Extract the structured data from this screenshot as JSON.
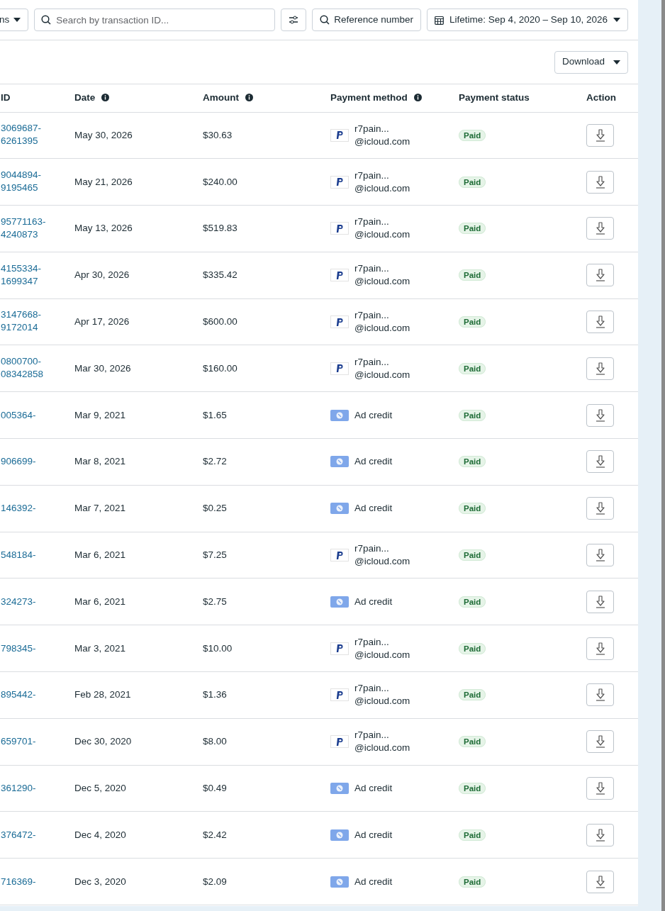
{
  "toolbar": {
    "cut_button": "ns",
    "search": {
      "placeholder": "Search by transaction ID..."
    },
    "reference_button": "Reference number",
    "date_range": "Lifetime: Sep 4, 2020 – Sep 10, 2026"
  },
  "download_button": "Download",
  "table": {
    "columns": [
      {
        "label": "ID",
        "info": false
      },
      {
        "label": "Date",
        "info": true
      },
      {
        "label": "Amount",
        "info": true
      },
      {
        "label": "Payment method",
        "info": true
      },
      {
        "label": "Payment status",
        "info": false
      },
      {
        "label": "Action",
        "info": false
      }
    ],
    "rows": [
      {
        "id": [
          "3069687-",
          "6261395"
        ],
        "date": "May 30, 2026",
        "amount": "$30.63",
        "method": {
          "kind": "paypal",
          "lines": [
            "r7pain...",
            "@icloud.com"
          ]
        },
        "status": "Paid"
      },
      {
        "id": [
          "9044894-",
          "9195465"
        ],
        "date": "May 21, 2026",
        "amount": "$240.00",
        "method": {
          "kind": "paypal",
          "lines": [
            "r7pain...",
            "@icloud.com"
          ]
        },
        "status": "Paid"
      },
      {
        "id": [
          "95771163-",
          "4240873"
        ],
        "date": "May 13, 2026",
        "amount": "$519.83",
        "method": {
          "kind": "paypal",
          "lines": [
            "r7pain...",
            "@icloud.com"
          ]
        },
        "status": "Paid"
      },
      {
        "id": [
          "4155334-",
          "1699347"
        ],
        "date": "Apr 30, 2026",
        "amount": "$335.42",
        "method": {
          "kind": "paypal",
          "lines": [
            "r7pain...",
            "@icloud.com"
          ]
        },
        "status": "Paid"
      },
      {
        "id": [
          "3147668-",
          "9172014"
        ],
        "date": "Apr 17, 2026",
        "amount": "$600.00",
        "method": {
          "kind": "paypal",
          "lines": [
            "r7pain...",
            "@icloud.com"
          ]
        },
        "status": "Paid"
      },
      {
        "id": [
          "0800700-",
          "08342858"
        ],
        "date": "Mar 30, 2026",
        "amount": "$160.00",
        "method": {
          "kind": "paypal",
          "lines": [
            "r7pain...",
            "@icloud.com"
          ]
        },
        "status": "Paid"
      },
      {
        "id": [
          "005364-"
        ],
        "date": "Mar 9, 2021",
        "amount": "$1.65",
        "method": {
          "kind": "ad_credit",
          "lines": [
            "Ad credit"
          ]
        },
        "status": "Paid"
      },
      {
        "id": [
          "906699-"
        ],
        "date": "Mar 8, 2021",
        "amount": "$2.72",
        "method": {
          "kind": "ad_credit",
          "lines": [
            "Ad credit"
          ]
        },
        "status": "Paid"
      },
      {
        "id": [
          "146392-"
        ],
        "date": "Mar 7, 2021",
        "amount": "$0.25",
        "method": {
          "kind": "ad_credit",
          "lines": [
            "Ad credit"
          ]
        },
        "status": "Paid"
      },
      {
        "id": [
          "548184-"
        ],
        "date": "Mar 6, 2021",
        "amount": "$7.25",
        "method": {
          "kind": "paypal",
          "lines": [
            "r7pain...",
            "@icloud.com"
          ]
        },
        "status": "Paid"
      },
      {
        "id": [
          "324273-"
        ],
        "date": "Mar 6, 2021",
        "amount": "$2.75",
        "method": {
          "kind": "ad_credit",
          "lines": [
            "Ad credit"
          ]
        },
        "status": "Paid"
      },
      {
        "id": [
          "798345-"
        ],
        "date": "Mar 3, 2021",
        "amount": "$10.00",
        "method": {
          "kind": "paypal",
          "lines": [
            "r7pain...",
            "@icloud.com"
          ]
        },
        "status": "Paid"
      },
      {
        "id": [
          "895442-"
        ],
        "date": "Feb 28, 2021",
        "amount": "$1.36",
        "method": {
          "kind": "paypal",
          "lines": [
            "r7pain...",
            "@icloud.com"
          ]
        },
        "status": "Paid"
      },
      {
        "id": [
          "659701-"
        ],
        "date": "Dec 30, 2020",
        "amount": "$8.00",
        "method": {
          "kind": "paypal",
          "lines": [
            "r7pain...",
            "@icloud.com"
          ]
        },
        "status": "Paid"
      },
      {
        "id": [
          "361290-"
        ],
        "date": "Dec 5, 2020",
        "amount": "$0.49",
        "method": {
          "kind": "ad_credit",
          "lines": [
            "Ad credit"
          ]
        },
        "status": "Paid"
      },
      {
        "id": [
          "376472-"
        ],
        "date": "Dec 4, 2020",
        "amount": "$2.42",
        "method": {
          "kind": "ad_credit",
          "lines": [
            "Ad credit"
          ]
        },
        "status": "Paid"
      },
      {
        "id": [
          "716369-"
        ],
        "date": "Dec 3, 2020",
        "amount": "$2.09",
        "method": {
          "kind": "ad_credit",
          "lines": [
            "Ad credit"
          ]
        },
        "status": "Paid"
      }
    ]
  }
}
